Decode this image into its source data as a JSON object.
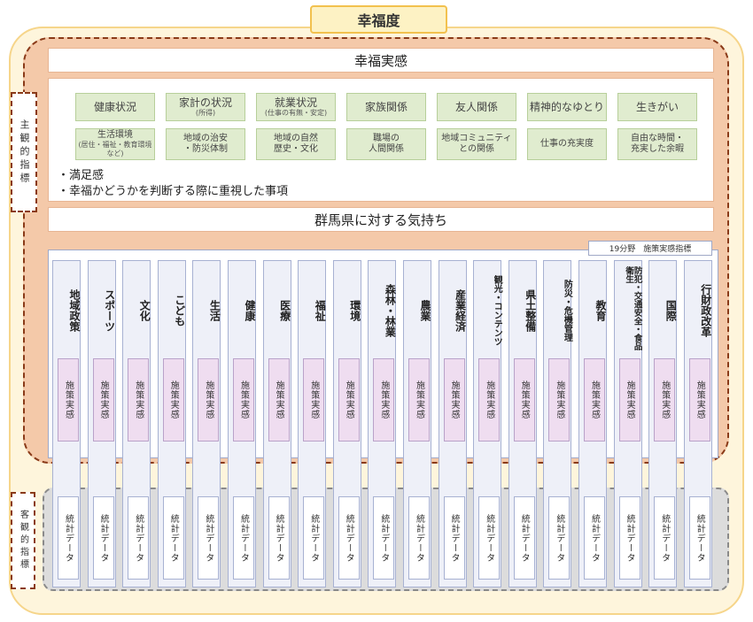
{
  "title": "幸福度",
  "bands": {
    "happiness": "幸福実感",
    "gunma": "群馬県に対する気持ち"
  },
  "side_labels": {
    "subjective": "主観的指標",
    "objective": "客観的指標"
  },
  "factors_row1": [
    {
      "main": "健康状況",
      "sub": ""
    },
    {
      "main": "家計の状況",
      "sub": "(所得)"
    },
    {
      "main": "就業状況",
      "sub": "(仕事の有無・安定)"
    },
    {
      "main": "家族関係",
      "sub": ""
    },
    {
      "main": "友人関係",
      "sub": ""
    },
    {
      "main": "精神的なゆとり",
      "sub": ""
    },
    {
      "main": "生きがい",
      "sub": ""
    }
  ],
  "factors_row2": [
    {
      "main": "生活環境",
      "sub": "(居住・福祉・教育環境など)"
    },
    {
      "main": "地域の治安\n・防災体制",
      "sub": ""
    },
    {
      "main": "地域の自然\n歴史・文化",
      "sub": ""
    },
    {
      "main": "職場の\n人間関係",
      "sub": ""
    },
    {
      "main": "地域コミュニティ\nとの関係",
      "sub": ""
    },
    {
      "main": "仕事の充実度",
      "sub": ""
    },
    {
      "main": "自由な時間・\n充実した余暇",
      "sub": ""
    }
  ],
  "satisfaction": {
    "line1": "・満足感",
    "line2": "・幸福かどうかを判断する際に重視した事項"
  },
  "policy_badge": "19分野　施策実感指標",
  "box_labels": {
    "policy": "施策実感",
    "stats": "統計データ"
  },
  "fields": [
    "地域政策",
    "スポーツ",
    "文化",
    "こども",
    "生活",
    "健康",
    "医療",
    "福祉",
    "環境",
    "森林・林業",
    "農業",
    "産業経済",
    "観光・コンテンツ",
    "県土整備",
    "防災・危機管理",
    "教育",
    "防犯・交通安全・食品衛生",
    "国際",
    "行財政改革"
  ],
  "colors": {
    "title_fill": "#fdf2c4",
    "outer_fill": "#fef5dc",
    "subjective_fill": "#f4c9a9",
    "factor_fill": "#e0eccf",
    "policy_box_fill": "#efddf0",
    "column_fill": "#eef0f8",
    "objective_fill": "#dcdcdc"
  }
}
